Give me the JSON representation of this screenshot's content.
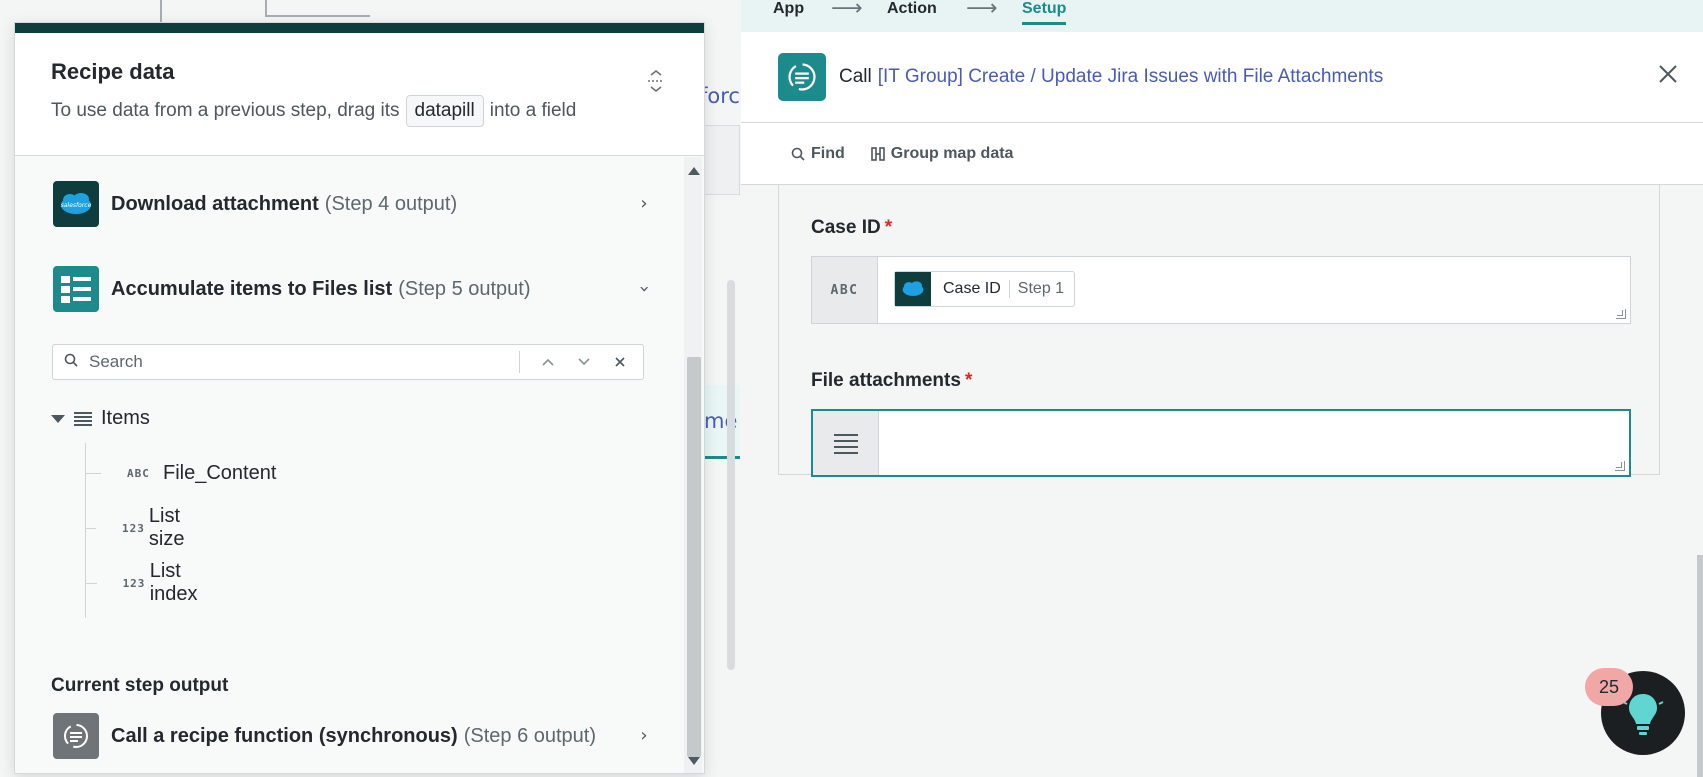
{
  "background_canvas": {
    "ghost_text_1": "force",
    "ghost_text_2": "me"
  },
  "recipe_data": {
    "title": "Recipe data",
    "subtitle_before": "To use data from a previous step, drag its",
    "datapill_label": "datapill",
    "subtitle_after": "into a field",
    "steps": [
      {
        "name": "Download attachment",
        "output": "(Step 4 output)",
        "icon": "salesforce-icon",
        "expanded": false
      },
      {
        "name": "Accumulate items to Files list",
        "output": "(Step 5 output)",
        "icon": "list-icon",
        "expanded": true
      }
    ],
    "search_placeholder": "Search",
    "tree": {
      "root_label": "Items",
      "children": [
        {
          "type": "ABC",
          "name": "File_Content"
        },
        {
          "type": "123",
          "name": "List size"
        },
        {
          "type": "123",
          "name": "List index"
        }
      ]
    },
    "current_step_title": "Current step output",
    "current_step": {
      "name": "Call a recipe function (synchronous)",
      "output": "(Step 6 output)",
      "icon": "recipe-function-icon"
    }
  },
  "wizard": {
    "steps": [
      "App",
      "Action",
      "Setup"
    ],
    "active": "Setup"
  },
  "call_panel": {
    "prefix": "Call",
    "recipe_name": "[IT Group] Create / Update Jira Issues with File Attachments",
    "toolbar": {
      "find_label": "Find",
      "group_map_label": "Group map data"
    },
    "fields": [
      {
        "label": "Case ID",
        "required": "*",
        "type": "ABC",
        "pill_name": "Case ID",
        "pill_step": "Step 1"
      },
      {
        "label": "File attachments",
        "required": "*",
        "type_icon": "list-icon"
      }
    ]
  },
  "help": {
    "badge_count": "25"
  },
  "colors": {
    "accent": "#1d8a8c",
    "salesforce_dark": "#0f3d3e",
    "link": "#4a5bb5",
    "required": "#d42a2a"
  }
}
